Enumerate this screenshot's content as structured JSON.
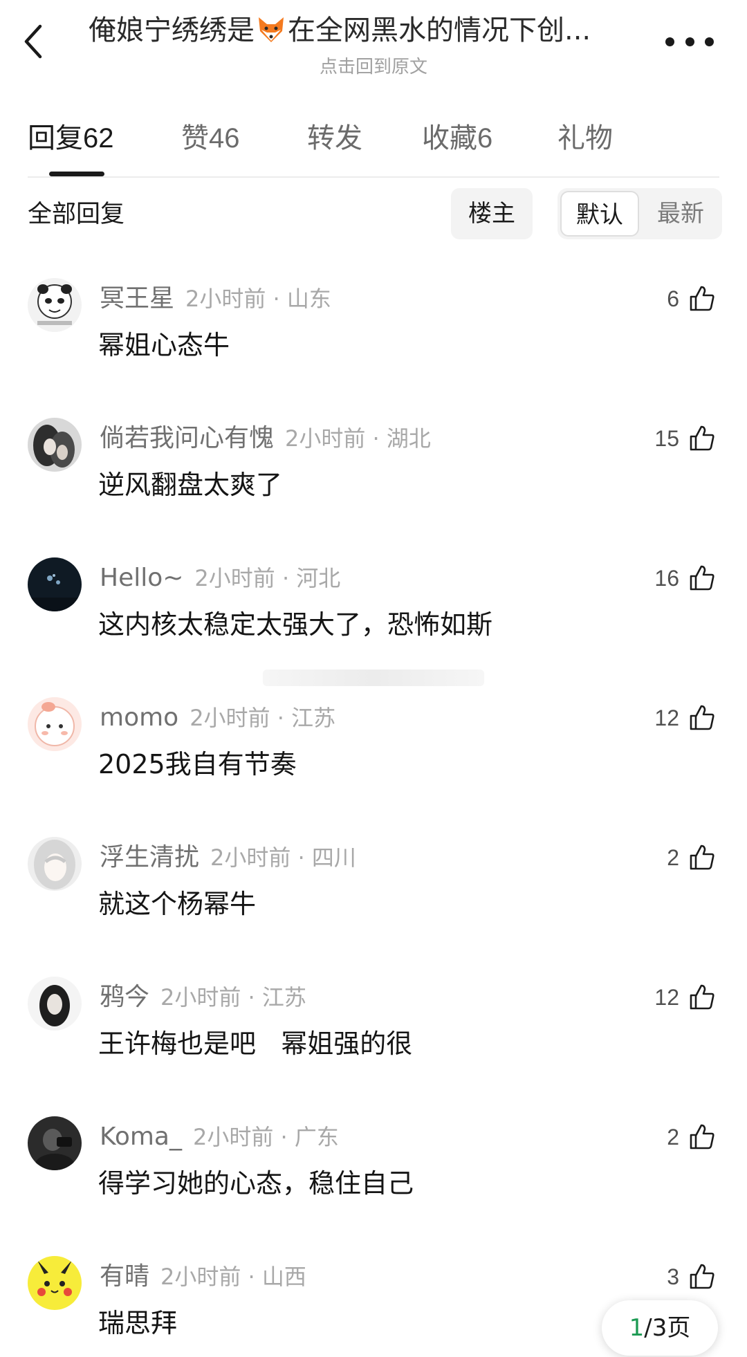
{
  "header": {
    "title_before": "俺娘宁绣绣是",
    "title_after": "在全网黑水的情况下创...",
    "subtitle": "点击回到原文"
  },
  "tabs": [
    {
      "label": "回复",
      "count": "62"
    },
    {
      "label": "赞",
      "count": "46"
    },
    {
      "label": "转发",
      "count": ""
    },
    {
      "label": "收藏",
      "count": "6"
    },
    {
      "label": "礼物",
      "count": ""
    }
  ],
  "filter": {
    "label": "全部回复",
    "host": "楼主",
    "sort_default": "默认",
    "sort_latest": "最新"
  },
  "comments": [
    {
      "user": "冥王星",
      "time": "2小时前 · 山东",
      "content": "幂姐心态牛",
      "likes": "6"
    },
    {
      "user": "倘若我问心有愧",
      "time": "2小时前 · 湖北",
      "content": "逆风翻盘太爽了",
      "likes": "15"
    },
    {
      "user": "Hello~",
      "time": "2小时前 · 河北",
      "content": "这内核太稳定太强大了，恐怖如斯",
      "likes": "16"
    },
    {
      "user": "momo",
      "time": "2小时前 · 江苏",
      "content": "2025我自有节奏",
      "likes": "12"
    },
    {
      "user": "浮生清扰",
      "time": "2小时前 · 四川",
      "content": "就这个杨幂牛",
      "likes": "2"
    },
    {
      "user": "鸦今",
      "time": "2小时前 · 江苏",
      "content": "王许梅也是吧   幂姐强的很",
      "likes": "12"
    },
    {
      "user": "Koma_",
      "time": "2小时前 · 广东",
      "content": "得学习她的心态，稳住自己",
      "likes": "2"
    },
    {
      "user": "有晴",
      "time": "2小时前 · 山西",
      "content": "瑞思拜",
      "likes": "3"
    }
  ],
  "pager": {
    "current": "1",
    "total": "/3页"
  },
  "colors": {
    "accent_green": "#1c9a53",
    "text_primary": "#1a1a1a",
    "text_secondary": "#707070"
  }
}
